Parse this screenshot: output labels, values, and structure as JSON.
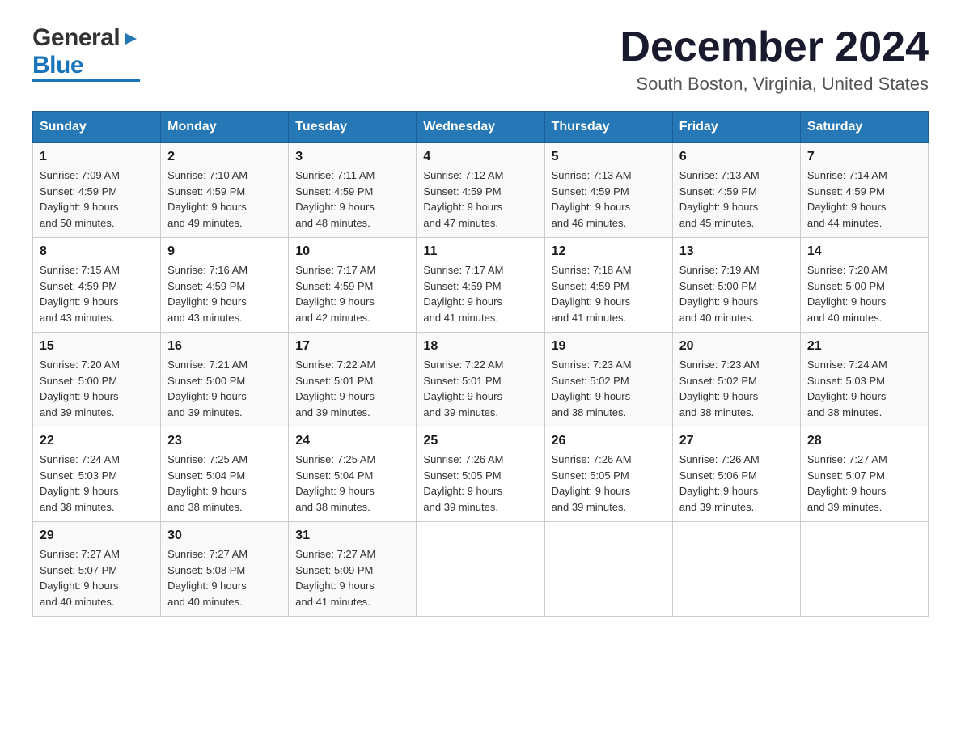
{
  "header": {
    "logo": {
      "general": "General",
      "arrow": "▶",
      "blue": "Blue"
    },
    "title": "December 2024",
    "location": "South Boston, Virginia, United States"
  },
  "weekdays": [
    "Sunday",
    "Monday",
    "Tuesday",
    "Wednesday",
    "Thursday",
    "Friday",
    "Saturday"
  ],
  "weeks": [
    [
      {
        "day": "1",
        "sunrise": "7:09 AM",
        "sunset": "4:59 PM",
        "daylight": "9 hours and 50 minutes."
      },
      {
        "day": "2",
        "sunrise": "7:10 AM",
        "sunset": "4:59 PM",
        "daylight": "9 hours and 49 minutes."
      },
      {
        "day": "3",
        "sunrise": "7:11 AM",
        "sunset": "4:59 PM",
        "daylight": "9 hours and 48 minutes."
      },
      {
        "day": "4",
        "sunrise": "7:12 AM",
        "sunset": "4:59 PM",
        "daylight": "9 hours and 47 minutes."
      },
      {
        "day": "5",
        "sunrise": "7:13 AM",
        "sunset": "4:59 PM",
        "daylight": "9 hours and 46 minutes."
      },
      {
        "day": "6",
        "sunrise": "7:13 AM",
        "sunset": "4:59 PM",
        "daylight": "9 hours and 45 minutes."
      },
      {
        "day": "7",
        "sunrise": "7:14 AM",
        "sunset": "4:59 PM",
        "daylight": "9 hours and 44 minutes."
      }
    ],
    [
      {
        "day": "8",
        "sunrise": "7:15 AM",
        "sunset": "4:59 PM",
        "daylight": "9 hours and 43 minutes."
      },
      {
        "day": "9",
        "sunrise": "7:16 AM",
        "sunset": "4:59 PM",
        "daylight": "9 hours and 43 minutes."
      },
      {
        "day": "10",
        "sunrise": "7:17 AM",
        "sunset": "4:59 PM",
        "daylight": "9 hours and 42 minutes."
      },
      {
        "day": "11",
        "sunrise": "7:17 AM",
        "sunset": "4:59 PM",
        "daylight": "9 hours and 41 minutes."
      },
      {
        "day": "12",
        "sunrise": "7:18 AM",
        "sunset": "4:59 PM",
        "daylight": "9 hours and 41 minutes."
      },
      {
        "day": "13",
        "sunrise": "7:19 AM",
        "sunset": "5:00 PM",
        "daylight": "9 hours and 40 minutes."
      },
      {
        "day": "14",
        "sunrise": "7:20 AM",
        "sunset": "5:00 PM",
        "daylight": "9 hours and 40 minutes."
      }
    ],
    [
      {
        "day": "15",
        "sunrise": "7:20 AM",
        "sunset": "5:00 PM",
        "daylight": "9 hours and 39 minutes."
      },
      {
        "day": "16",
        "sunrise": "7:21 AM",
        "sunset": "5:00 PM",
        "daylight": "9 hours and 39 minutes."
      },
      {
        "day": "17",
        "sunrise": "7:22 AM",
        "sunset": "5:01 PM",
        "daylight": "9 hours and 39 minutes."
      },
      {
        "day": "18",
        "sunrise": "7:22 AM",
        "sunset": "5:01 PM",
        "daylight": "9 hours and 39 minutes."
      },
      {
        "day": "19",
        "sunrise": "7:23 AM",
        "sunset": "5:02 PM",
        "daylight": "9 hours and 38 minutes."
      },
      {
        "day": "20",
        "sunrise": "7:23 AM",
        "sunset": "5:02 PM",
        "daylight": "9 hours and 38 minutes."
      },
      {
        "day": "21",
        "sunrise": "7:24 AM",
        "sunset": "5:03 PM",
        "daylight": "9 hours and 38 minutes."
      }
    ],
    [
      {
        "day": "22",
        "sunrise": "7:24 AM",
        "sunset": "5:03 PM",
        "daylight": "9 hours and 38 minutes."
      },
      {
        "day": "23",
        "sunrise": "7:25 AM",
        "sunset": "5:04 PM",
        "daylight": "9 hours and 38 minutes."
      },
      {
        "day": "24",
        "sunrise": "7:25 AM",
        "sunset": "5:04 PM",
        "daylight": "9 hours and 38 minutes."
      },
      {
        "day": "25",
        "sunrise": "7:26 AM",
        "sunset": "5:05 PM",
        "daylight": "9 hours and 39 minutes."
      },
      {
        "day": "26",
        "sunrise": "7:26 AM",
        "sunset": "5:05 PM",
        "daylight": "9 hours and 39 minutes."
      },
      {
        "day": "27",
        "sunrise": "7:26 AM",
        "sunset": "5:06 PM",
        "daylight": "9 hours and 39 minutes."
      },
      {
        "day": "28",
        "sunrise": "7:27 AM",
        "sunset": "5:07 PM",
        "daylight": "9 hours and 39 minutes."
      }
    ],
    [
      {
        "day": "29",
        "sunrise": "7:27 AM",
        "sunset": "5:07 PM",
        "daylight": "9 hours and 40 minutes."
      },
      {
        "day": "30",
        "sunrise": "7:27 AM",
        "sunset": "5:08 PM",
        "daylight": "9 hours and 40 minutes."
      },
      {
        "day": "31",
        "sunrise": "7:27 AM",
        "sunset": "5:09 PM",
        "daylight": "9 hours and 41 minutes."
      },
      null,
      null,
      null,
      null
    ]
  ]
}
